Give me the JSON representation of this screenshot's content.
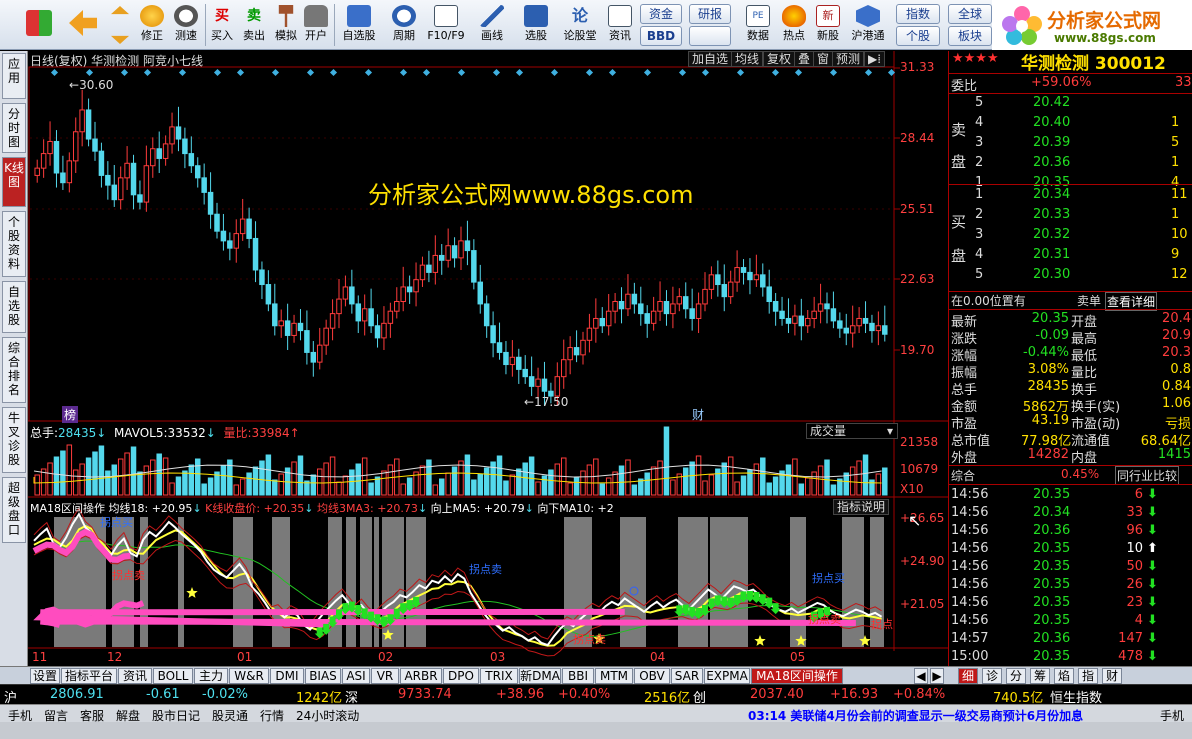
{
  "toolbar": {
    "buttons": [
      "修正",
      "测速",
      "买入",
      "卖出",
      "模拟",
      "开户",
      "自选股",
      "周期",
      "F10/F9",
      "画线",
      "选股",
      "论股堂",
      "资讯",
      "数据",
      "热点",
      "新股",
      "沪港通"
    ],
    "pills": [
      "资金",
      "研报",
      "BBD",
      "指数",
      "全球",
      "个股",
      "板块"
    ],
    "brand_title": "分析家公式网",
    "brand_url": "www.88gs.com"
  },
  "vtabs": [
    "应用",
    "分时图",
    "K线图",
    "个股资料",
    "自选股",
    "综合排名",
    "牛叉诊股",
    "超级盘口"
  ],
  "chart": {
    "header_left": "日线(复权)  华测检测  阿竞小七线",
    "header_buttons": [
      "加自选",
      "均线",
      "复权",
      "叠",
      "窗",
      "预测"
    ],
    "watermark": "分析家公式网www.88gs.com",
    "price_axis": [
      "31.33",
      "28.44",
      "25.51",
      "22.63",
      "19.70"
    ],
    "high_label": "30.60",
    "low_label": "17.50",
    "tag_left": "榜",
    "tag_right": "财",
    "vol_header": {
      "total_label": "总手:",
      "total": "28435",
      "mavol_label": "MAVOL5:",
      "mavol": "33532",
      "ratio_label": "量比:",
      "ratio": "33984"
    },
    "vol_button": "成交量",
    "vol_axis": [
      "21358",
      "10679",
      "X10"
    ],
    "ind_header": {
      "name": "MA18区间操作",
      "a": "均线18: +20.95",
      "b": "K线收盘价: +20.35",
      "c": "均线3MA3: +20.73",
      "d": "向上MA5: +20.79",
      "e": "向下MA10: +2"
    },
    "ind_button": "指标说明",
    "ind_axis": [
      "+26.65",
      "+24.90",
      "+21.05"
    ],
    "ind_labels": [
      "拐点买",
      "拐点卖",
      "拐点卖",
      "拐点卖",
      "拐点买",
      "拐点卖",
      "拐点"
    ],
    "date_axis": [
      "11",
      "12",
      "01",
      "02",
      "03",
      "04",
      "05"
    ]
  },
  "right": {
    "stars": "★★★★",
    "title": "华测检测 300012",
    "weibi_label": "委比",
    "weibi": "+59.06%",
    "weibi_r": "33",
    "sell_label": [
      "卖",
      "盘"
    ],
    "buy_label": [
      "买",
      "盘"
    ],
    "sells": [
      [
        "5",
        "20.42",
        ""
      ],
      [
        "4",
        "20.40",
        "1"
      ],
      [
        "3",
        "20.39",
        "5"
      ],
      [
        "2",
        "20.36",
        "1"
      ],
      [
        "1",
        "20.35",
        "4"
      ]
    ],
    "buys": [
      [
        "1",
        "20.34",
        "11"
      ],
      [
        "2",
        "20.33",
        "1"
      ],
      [
        "3",
        "20.32",
        "10"
      ],
      [
        "4",
        "20.31",
        "9"
      ],
      [
        "5",
        "20.30",
        "12"
      ]
    ],
    "pos_label": "在0.00位置有",
    "pos_right": "卖单",
    "pos_link": "查看详细",
    "stats": [
      [
        "最新",
        "20.35",
        "开盘",
        "20.4"
      ],
      [
        "涨跌",
        "-0.09",
        "最高",
        "20.9"
      ],
      [
        "涨幅",
        "-0.44%",
        "最低",
        "20.3"
      ],
      [
        "振幅",
        "3.08%",
        "量比",
        "0.8"
      ],
      [
        "总手",
        "28435",
        "换手",
        "0.84"
      ],
      [
        "金额",
        "5862万",
        "换手(实)",
        "1.06"
      ],
      [
        "市盈",
        "43.19",
        "市盈(动)",
        "亏损"
      ],
      [
        "总市值",
        "77.98亿",
        "流通值",
        "68.64亿"
      ],
      [
        "外盘",
        "14282",
        "内盘",
        "1415"
      ]
    ],
    "zonghe_label": "综合",
    "zonghe_val": "0.45%",
    "zonghe_btn": "同行业比较",
    "ticks": [
      [
        "14:56",
        "20.35",
        "6",
        "down"
      ],
      [
        "14:56",
        "20.34",
        "33",
        "down"
      ],
      [
        "14:56",
        "20.36",
        "96",
        "down"
      ],
      [
        "14:56",
        "20.35",
        "10",
        "up"
      ],
      [
        "14:56",
        "20.35",
        "50",
        "down"
      ],
      [
        "14:56",
        "20.35",
        "26",
        "down"
      ],
      [
        "14:56",
        "20.35",
        "23",
        "down"
      ],
      [
        "14:56",
        "20.35",
        "4",
        "down"
      ],
      [
        "14:57",
        "20.36",
        "147",
        "down"
      ],
      [
        "15:00",
        "20.35",
        "478",
        "down"
      ]
    ]
  },
  "bottom_tabs": [
    "设置",
    "指标平台",
    "资讯",
    "BOLL",
    "主力",
    "W&R",
    "DMI",
    "BIAS",
    "ASI",
    "VR",
    "ARBR",
    "DPO",
    "TRIX",
    "新DMA",
    "BBI",
    "MTM",
    "OBV",
    "SAR",
    "EXPMA",
    "MA18区间操作"
  ],
  "right_tabs": [
    "细",
    "诊",
    "分",
    "筹",
    "焰",
    "指",
    "财"
  ],
  "index_bar": {
    "sh_label": "沪",
    "sh": "2806.91",
    "sh_chg": "-0.61",
    "sh_pct": "-0.02%",
    "sh_amt": "1242亿",
    "sz_label": "深",
    "sz": "9733.74",
    "sz_chg": "+38.96",
    "sz_pct": "+0.40%",
    "sz_amt": "2516亿",
    "cy_label": "创",
    "cy": "2037.40",
    "cy_chg": "+16.93",
    "cy_pct": "+0.84%",
    "cy_amt": "740.5亿",
    "hk_label": "恒生指数"
  },
  "status_bar": {
    "items": [
      "手机",
      "留言",
      "客服",
      "解盘",
      "股市日记",
      "股灵通",
      "行情",
      "24小时滚动"
    ],
    "news": "03:14 美联储4月份会前的调查显示一级交易商预计6月份加息",
    "end": "手机"
  },
  "colors": {
    "up": "#ff3c3c",
    "down": "#4fe0ef",
    "green": "#22e022",
    "yellow": "#ffff3c",
    "panel_border": "#a00000"
  }
}
